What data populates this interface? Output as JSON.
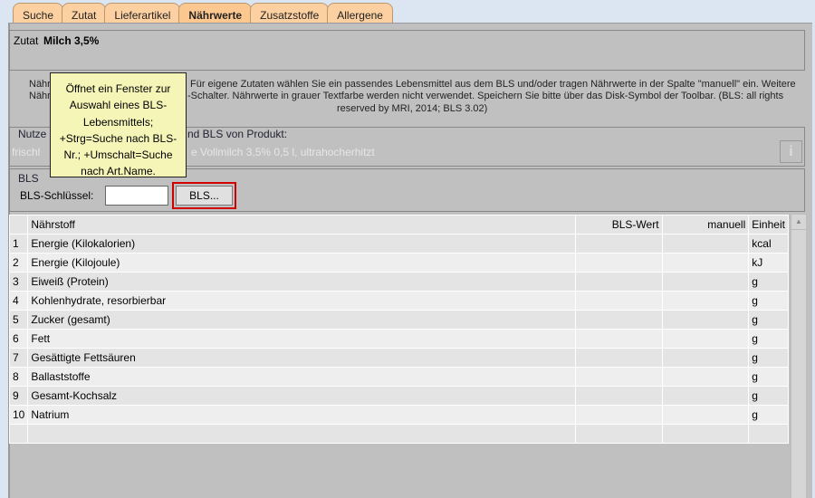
{
  "tabs": [
    "Suche",
    "Zutat",
    "Lieferartikel",
    "Nährwerte",
    "Zusatzstoffe",
    "Allergene"
  ],
  "header": {
    "label": "Zutat",
    "name": "Milch 3,5%"
  },
  "info": {
    "l1a": "Nährw",
    "l1b": "Für eigene Zutaten wählen Sie ein passendes Lebensmittel aus dem BLS und/oder tragen Nährwerte in der Spalte \"manuell\" ein. Weitere",
    "l2a": "Nähr",
    "l2b": "-Schalter. Nährwerte in grauer Textfarbe werden nicht verwendet. Speichern Sie bitte über das Disk-Symbol der Toolbar. (BLS: all rights",
    "l3": "reserved by MRI, 2014; BLS 3.02)"
  },
  "product": {
    "title_a": "Nutze",
    "title_b": "nd BLS von Produkt:",
    "value_a": "frischl",
    "value_b": "e Vollmilch 3,5% 0,5 l, ultrahocherhitzt",
    "info_icon": "i"
  },
  "bls": {
    "title": "BLS",
    "key_label": "BLS-Schlüssel:",
    "key_value": "",
    "button": "BLS..."
  },
  "tooltip": [
    "Öffnet ein Fenster zur",
    "Auswahl eines BLS-",
    "Lebensmittels;",
    "+Strg=Suche nach BLS-",
    "Nr.; +Umschalt=Suche",
    "nach Art.Name."
  ],
  "table": {
    "headers": [
      "",
      "Nährstoff",
      "BLS-Wert",
      "manuell",
      "Einheit"
    ],
    "rows": [
      [
        "1",
        "Energie (Kilokalorien)",
        "",
        "",
        "kcal"
      ],
      [
        "2",
        "Energie (Kilojoule)",
        "",
        "",
        "kJ"
      ],
      [
        "3",
        "Eiweiß (Protein)",
        "",
        "",
        "g"
      ],
      [
        "4",
        "Kohlenhydrate, resorbierbar",
        "",
        "",
        "g"
      ],
      [
        "5",
        "Zucker (gesamt)",
        "",
        "",
        "g"
      ],
      [
        "6",
        "Fett",
        "",
        "",
        "g"
      ],
      [
        "7",
        "Gesättigte Fettsäuren",
        "",
        "",
        "g"
      ],
      [
        "8",
        "Ballaststoffe",
        "",
        "",
        "g"
      ],
      [
        "9",
        "Gesamt-Kochsalz",
        "",
        "",
        "g"
      ],
      [
        "10",
        "Natrium",
        "",
        "",
        "g"
      ],
      [
        "",
        "",
        "",
        "",
        "",
        ""
      ]
    ]
  }
}
